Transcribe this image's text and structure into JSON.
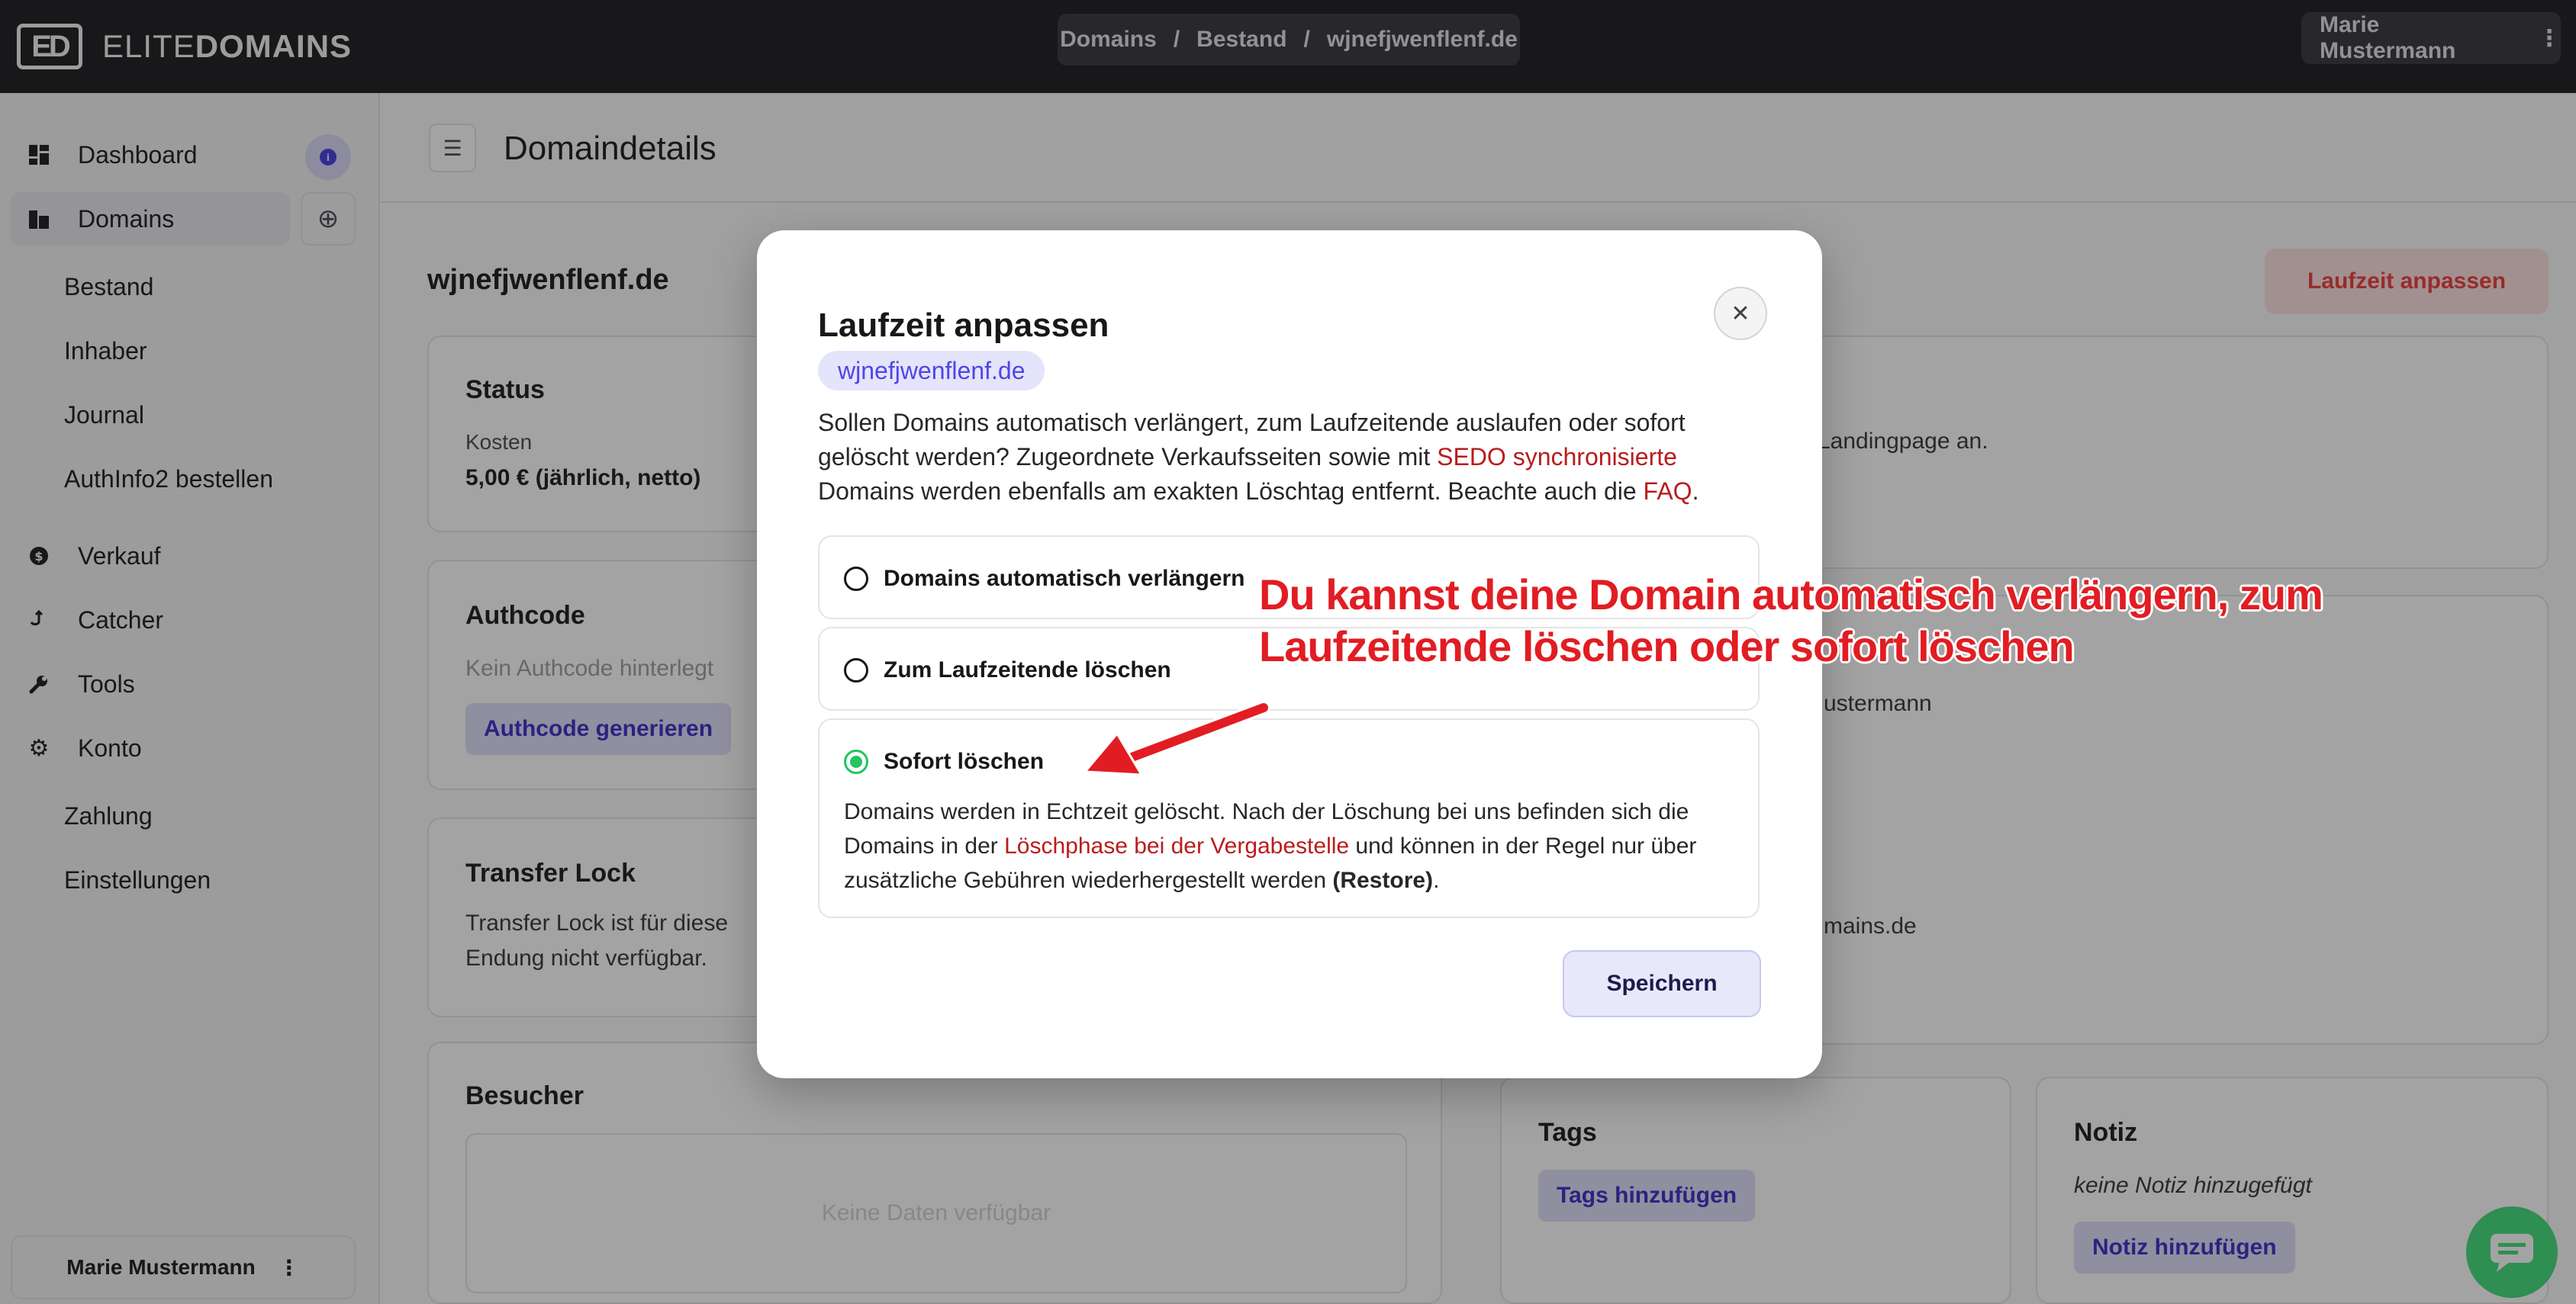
{
  "app": {
    "logo_mark": "ED",
    "logo_text_light": "ELITE",
    "logo_text_bold": "DOMAINS",
    "user_name": "Marie Mustermann"
  },
  "breadcrumb": [
    "Domains",
    "Bestand",
    "wjnefjwenflenf.de"
  ],
  "breadcrumb_separator": "/",
  "sidebar": {
    "items": [
      {
        "label": "Dashboard",
        "icon": "dashboard-icon"
      },
      {
        "label": "Domains",
        "icon": "domains-icon"
      },
      {
        "label": "Bestand"
      },
      {
        "label": "Inhaber"
      },
      {
        "label": "Journal"
      },
      {
        "label": "AuthInfo2 bestellen"
      },
      {
        "label": "Verkauf",
        "icon": "dollar-icon"
      },
      {
        "label": "Catcher",
        "icon": "catcher-icon"
      },
      {
        "label": "Tools",
        "icon": "wrench-icon"
      },
      {
        "label": "Konto",
        "icon": "gear-icon"
      },
      {
        "label": "Zahlung"
      },
      {
        "label": "Einstellungen"
      }
    ],
    "user_name": "Marie Mustermann"
  },
  "main": {
    "page_title": "Domaindetails",
    "domain": "wjnefjwenflenf.de",
    "laufzeit_button": "Laufzeit anpassen",
    "status": {
      "title": "Status",
      "cost_label": "Kosten",
      "cost_value": "5,00 € (jährlich, netto)"
    },
    "authcode": {
      "title": "Authcode",
      "empty": "Kein Authcode hinterlegt",
      "button": "Authcode generieren"
    },
    "transfer_lock": {
      "title": "Transfer Lock",
      "text_line1": "Transfer Lock ist für diese",
      "text_line2": "Endung nicht verfügbar."
    },
    "besucher": {
      "title": "Besucher",
      "empty": "Keine Daten verfügbar"
    },
    "right_fragments": {
      "landing": "Landingpage an.",
      "owner": "ustermann",
      "email": "mains.de"
    },
    "tags": {
      "title": "Tags",
      "button": "Tags hinzufügen"
    },
    "notiz": {
      "title": "Notiz",
      "empty": "keine Notiz hinzugefügt",
      "button": "Notiz hinzufügen"
    }
  },
  "modal": {
    "title": "Laufzeit anpassen",
    "domain_pill": "wjnefjwenflenf.de",
    "desc_part1": "Sollen Domains automatisch verlängert, zum Laufzeitende auslaufen oder sofort gelöscht werden? Zugeordnete Verkaufsseiten sowie mit ",
    "desc_link1": "SEDO synchronisierte",
    "desc_part2": " Domains werden ebenfalls am exakten Löschtag entfernt. Beachte auch die ",
    "desc_link2": "FAQ",
    "desc_part3": ".",
    "options": [
      {
        "label": "Domains automatisch verlängern",
        "selected": false
      },
      {
        "label": "Zum Laufzeitende löschen",
        "selected": false
      },
      {
        "label": "Sofort löschen",
        "selected": true
      }
    ],
    "option3_desc_part1": "Domains werden in Echtzeit gelöscht. Nach der Löschung bei uns befinden sich die Domains in der ",
    "option3_desc_link": "Löschphase bei der Vergabestelle",
    "option3_desc_part2": " und können in der Regel nur über zusätzliche Gebühren wiederhergestellt werden ",
    "option3_desc_bold": "(Restore)",
    "option3_desc_part3": ".",
    "save_button": "Speichern"
  },
  "annotation": {
    "line1": "Du kannst deine Domain automatisch verlängern, zum",
    "line2": "Laufzeitende löschen oder sofort löschen"
  },
  "colors": {
    "topbar": "#27272a",
    "accent": "#4f46e5",
    "link_red": "#b91c1c",
    "annotation_red": "#e11d23",
    "radio_selected": "#22c55e"
  }
}
